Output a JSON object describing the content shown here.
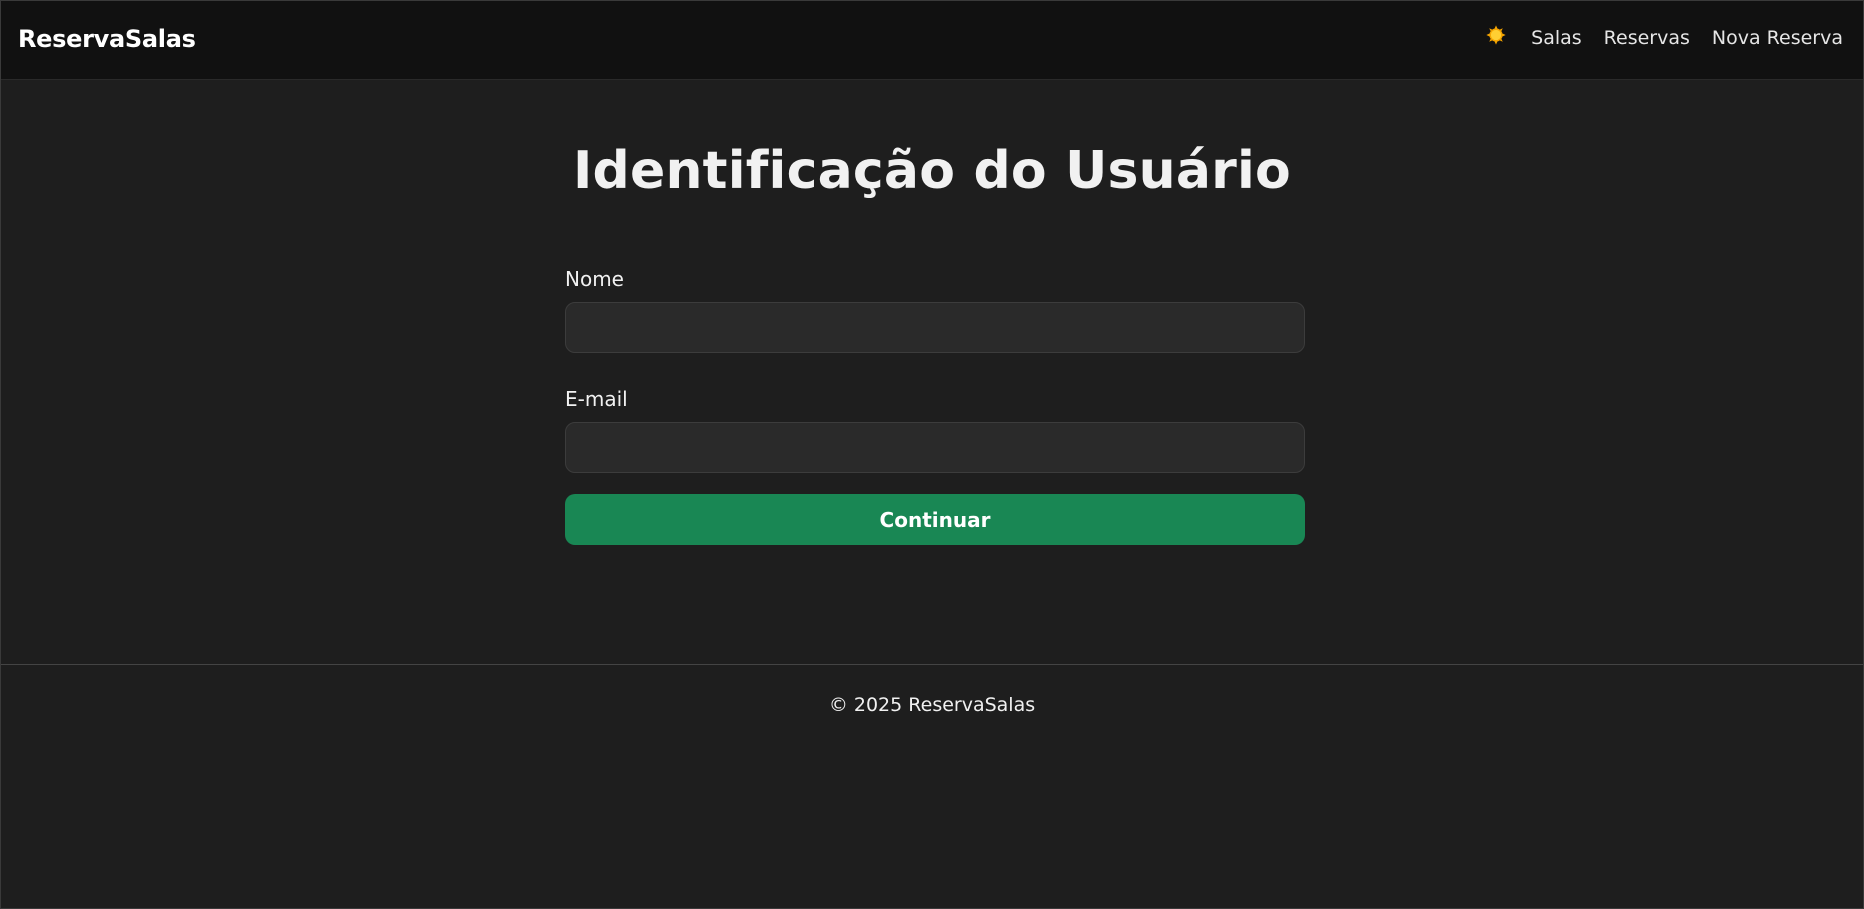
{
  "navbar": {
    "brand": "ReservaSalas",
    "theme_icon": "sun-icon",
    "links": [
      {
        "label": "Salas"
      },
      {
        "label": "Reservas"
      },
      {
        "label": "Nova Reserva"
      }
    ]
  },
  "main": {
    "title": "Identificação do Usuário",
    "form": {
      "name_label": "Nome",
      "name_value": "",
      "email_label": "E-mail",
      "email_value": "",
      "submit_label": "Continuar"
    }
  },
  "footer": {
    "text": "© 2025 ReservaSalas"
  },
  "colors": {
    "background": "#1e1e1e",
    "navbar": "#111111",
    "input_background": "#2a2a2a",
    "primary_button": "#198754",
    "sun": "#f5b700"
  }
}
